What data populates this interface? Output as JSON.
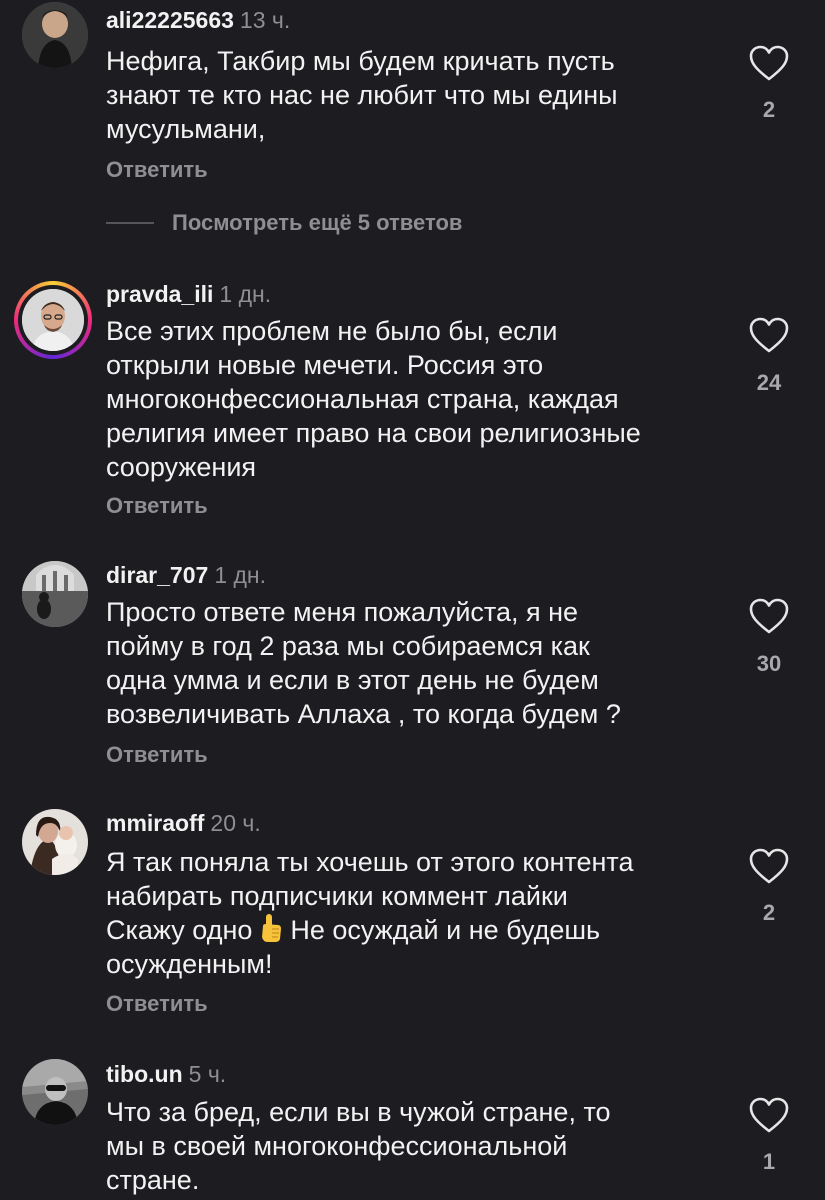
{
  "comments": [
    {
      "username": "ali22225663",
      "time": "13 ч.",
      "text": "Нефига, Такбир мы будем кричать пусть\nзнают те кто нас не любит что мы едины\nмусульмани,",
      "reply": "Ответить",
      "likes": "2"
    },
    {
      "username": "pravda_ili",
      "time": "1 дн.",
      "text": "Все этих проблем не было бы, если\nоткрыли новые мечети. Россия это\nмногоконфессиональная страна, каждая\nрелигия имеет право на свои религиозные\nсооружения",
      "reply": "Ответить",
      "likes": "24"
    },
    {
      "username": "dirar_707",
      "time": "1 дн.",
      "text": "Просто ответе меня пожалуйста, я не\nпойму в год 2 раза мы собираемся как\nодна умма и если в этот день не будем\nвозвеличивать  Аллаха , то когда будем ?",
      "reply": "Ответить",
      "likes": "30"
    },
    {
      "username": "mmiraoff",
      "time": "20 ч.",
      "text_line1": "Я так поняла ты хочешь от этого контента",
      "text_line2": "набирать подписчики коммент лайки",
      "text_line3_before": "Скажу одно",
      "text_line3_after": "Не осуждай и не будешь",
      "text_line4": "осужденным!",
      "emoji": "index-finger-up-icon",
      "reply": "Ответить",
      "likes": "2"
    },
    {
      "username": "tibo.un",
      "time": "5 ч.",
      "text": "Что за бред, если вы в чужой стране, то\nмы в своей многоконфессиональной\nстране.",
      "likes": "1"
    }
  ],
  "view_more_replies": "Посмотреть ещё 5 ответов",
  "colors": {
    "background": "#1c1c21",
    "text": "#f2f2f2",
    "muted": "#8e8e93"
  }
}
